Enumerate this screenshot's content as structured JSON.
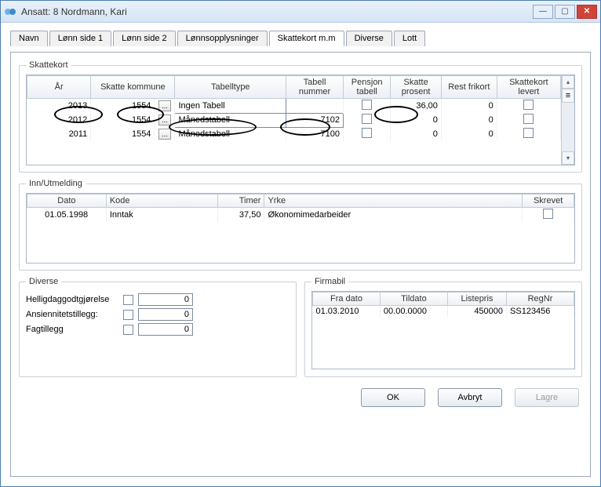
{
  "window": {
    "title": "Ansatt:  8  Nordmann, Kari"
  },
  "tabs": [
    "Navn",
    "Lønn side 1",
    "Lønn side 2",
    "Lønnsopplysninger",
    "Skattekort m.m",
    "Diverse",
    "Lott"
  ],
  "active_tab": 4,
  "skattekort": {
    "legend": "Skattekort",
    "headers": [
      "År",
      "Skatte kommune",
      "Tabelltype",
      "Tabell nummer",
      "Pensjon tabell",
      "Skatte prosent",
      "Rest frikort",
      "Skattekort levert"
    ],
    "rows": [
      {
        "year": "2013",
        "kommune": "1554",
        "tabelltype": "Ingen Tabell",
        "tabellnummer": "",
        "pensjon": false,
        "prosent": "36,00",
        "rest": "0",
        "levert": false
      },
      {
        "year": "2012",
        "kommune": "1554",
        "tabelltype": "Månedstabell",
        "tabellnummer": "7102",
        "pensjon": false,
        "prosent": "0",
        "rest": "0",
        "levert": false
      },
      {
        "year": "2011",
        "kommune": "1554",
        "tabelltype": "Månedstabell",
        "tabellnummer": "7100",
        "pensjon": false,
        "prosent": "0",
        "rest": "0",
        "levert": false
      }
    ]
  },
  "innut": {
    "legend": "Inn/Utmelding",
    "headers": [
      "Dato",
      "Kode",
      "Timer",
      "Yrke",
      "Skrevet"
    ],
    "rows": [
      {
        "dato": "01.05.1998",
        "kode": "Inntak",
        "timer": "37,50",
        "yrke": "Økonomimedarbeider",
        "skrevet": false
      }
    ]
  },
  "diverse": {
    "legend": "Diverse",
    "items": [
      {
        "label": "Helligdaggodtgjørelse",
        "checked": false,
        "value": "0"
      },
      {
        "label": "Ansiennitetstillegg:",
        "checked": false,
        "value": "0"
      },
      {
        "label": "Fagtillegg",
        "checked": false,
        "value": "0"
      }
    ]
  },
  "firmabil": {
    "legend": "Firmabil",
    "headers": [
      "Fra dato",
      "Tildato",
      "Listepris",
      "RegNr"
    ],
    "rows": [
      {
        "fra": "01.03.2010",
        "til": "00.00.0000",
        "listepris": "450000",
        "regnr": "SS123456"
      }
    ]
  },
  "buttons": {
    "ok": "OK",
    "cancel": "Avbryt",
    "save": "Lagre"
  },
  "annotations": {
    "circled": [
      "skattekort.rows.0.year",
      "skattekort.rows.0.kommune",
      "skattekort.rows.1.tabelltype",
      "skattekort.rows.1.tabellnummer",
      "skattekort.rows.0.prosent"
    ]
  }
}
